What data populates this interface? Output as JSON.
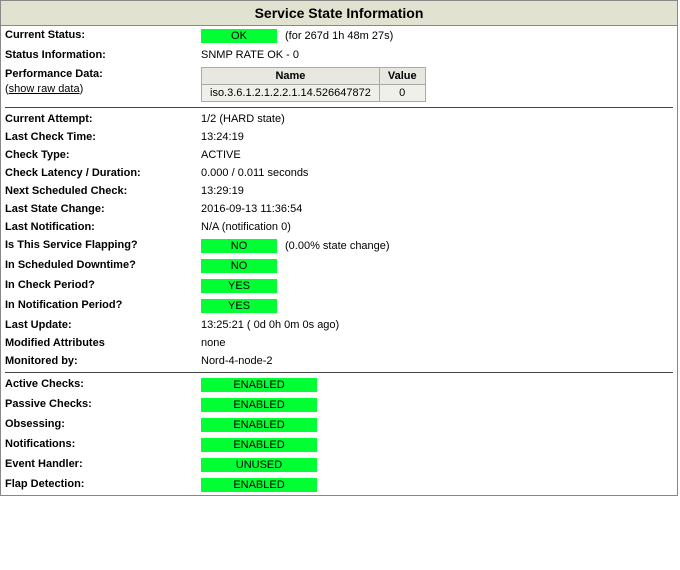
{
  "title": "Service State Information",
  "top": {
    "current_status_label": "Current Status:",
    "current_status_badge": "OK",
    "current_status_for": "(for 267d 1h 48m 27s)",
    "status_info_label": "Status Information:",
    "status_info_value": "SNMP RATE OK - 0",
    "perf_data_label": "Performance Data:",
    "show_raw_prefix": "(",
    "show_raw_link": "show raw data",
    "show_raw_suffix": ")",
    "perf_table": {
      "col_name": "Name",
      "col_value": "Value",
      "row_name": "iso.3.6.1.2.1.2.2.1.14.526647872",
      "row_value": "0"
    }
  },
  "mid": {
    "current_attempt_label": "Current Attempt:",
    "current_attempt_value": "1/2  (HARD state)",
    "last_check_label": "Last Check Time:",
    "last_check_value": "13:24:19",
    "check_type_label": "Check Type:",
    "check_type_value": "ACTIVE",
    "latency_label": "Check Latency / Duration:",
    "latency_value": "0.000 / 0.011 seconds",
    "next_check_label": "Next Scheduled Check:",
    "next_check_value": "13:29:19",
    "last_state_change_label": "Last State Change:",
    "last_state_change_value": "2016-09-13 11:36:54",
    "last_notification_label": "Last Notification:",
    "last_notification_value": "N/A (notification 0)",
    "flapping_label": "Is This Service Flapping?",
    "flapping_badge": "NO",
    "flapping_extra": "(0.00% state change)",
    "downtime_label": "In Scheduled Downtime?",
    "downtime_badge": "NO",
    "check_period_label": "In Check Period?",
    "check_period_badge": "YES",
    "notif_period_label": "In Notification Period?",
    "notif_period_badge": "YES",
    "last_update_label": "Last Update:",
    "last_update_value": "13:25:21  ( 0d 0h 0m 0s ago)",
    "mod_attr_label": "Modified Attributes",
    "mod_attr_value": "none",
    "monitored_by_label": "Monitored by:",
    "monitored_by_value": "Nord-4-node-2"
  },
  "bottom": {
    "active_checks_label": "Active Checks:",
    "active_checks_badge": "ENABLED",
    "passive_checks_label": "Passive Checks:",
    "passive_checks_badge": "ENABLED",
    "obsessing_label": "Obsessing:",
    "obsessing_badge": "ENABLED",
    "notifications_label": "Notifications:",
    "notifications_badge": "ENABLED",
    "event_handler_label": "Event Handler:",
    "event_handler_badge": "UNUSED",
    "flap_detection_label": "Flap Detection:",
    "flap_detection_badge": "ENABLED"
  }
}
